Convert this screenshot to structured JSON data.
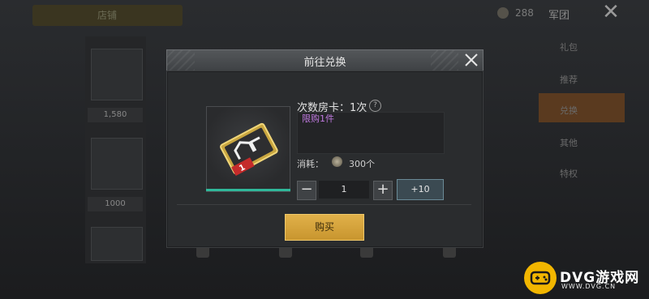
{
  "background": {
    "topbar_text": "店铺",
    "coin_count": "288",
    "tab_label": "军团",
    "prices": [
      "1,580",
      "1000"
    ],
    "side_menu": [
      "礼包",
      "推荐",
      "兑换",
      "其他",
      "特权"
    ]
  },
  "modal": {
    "title": "前往兑换",
    "item": {
      "name": "次数房卡：1次",
      "purchase_limit": "限购1件",
      "card_badge_number": "1"
    },
    "cost": {
      "label": "消耗：",
      "value": "300个"
    },
    "quantity": {
      "minus_label": "−",
      "value": "1",
      "plus_label": "+",
      "plus10_label": "+10"
    },
    "buy_label": "购买"
  },
  "watermark": {
    "title": "DVG游戏网",
    "url": "WWW.DVG.CN"
  },
  "colors": {
    "buy_button": "#d4a33d",
    "accent_teal": "#2fb89a",
    "limit_text": "#c07ae0",
    "watermark_badge": "#f2b600"
  }
}
